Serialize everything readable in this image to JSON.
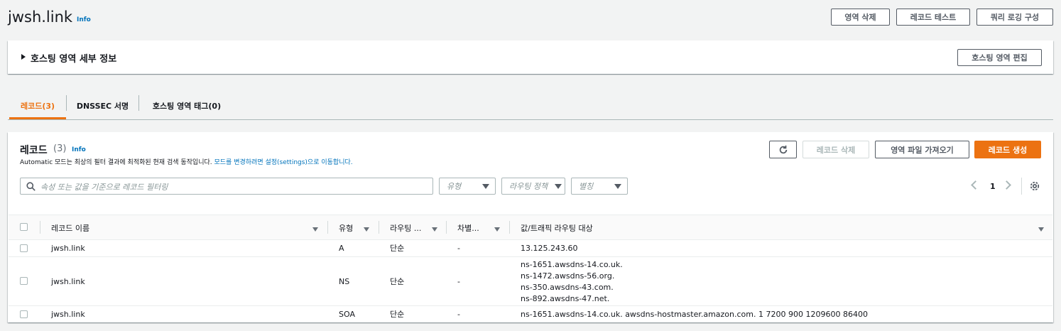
{
  "header": {
    "title": "jwsh.link",
    "info": "Info",
    "buttons": {
      "delete_zone": "영역 삭제",
      "test_record": "레코드 테스트",
      "query_logging": "쿼리 로깅 구성"
    }
  },
  "details": {
    "title": "호스팅 영역 세부 정보",
    "edit_button": "호스팅 영역 편집"
  },
  "tabs": [
    {
      "label": "레코드(3)",
      "active": true
    },
    {
      "label": "DNSSEC 서명",
      "active": false
    },
    {
      "label": "호스팅 영역 태그(0)",
      "active": false
    }
  ],
  "records": {
    "title": "레코드",
    "count": "(3)",
    "info": "Info",
    "description": "Automatic 모드는 최상의 필터 결과에 최적화된 현재 검색 동작입니다.",
    "description_link": "모드를 변경하려면 설정(settings)으로 이동합니다.",
    "buttons": {
      "delete": "레코드 삭제",
      "import": "영역 파일 가져오기",
      "create": "레코드 생성"
    },
    "search_placeholder": "속성 또는 값을 기준으로 레코드 필터링",
    "filters": {
      "type": "유형",
      "routing": "라우팅 정책",
      "alias": "별칭"
    },
    "page": "1",
    "columns": {
      "name": "레코드 이름",
      "type": "유형",
      "routing": "라우팅 ...",
      "differentiator": "차별...",
      "value": "값/트래픽 라우팅 대상"
    },
    "rows": [
      {
        "name": "jwsh.link",
        "type": "A",
        "routing": "단순",
        "diff": "-",
        "values": [
          "13.125.243.60"
        ]
      },
      {
        "name": "jwsh.link",
        "type": "NS",
        "routing": "단순",
        "diff": "-",
        "values": [
          "ns-1651.awsdns-14.co.uk.",
          "ns-1472.awsdns-56.org.",
          "ns-350.awsdns-43.com.",
          "ns-892.awsdns-47.net."
        ]
      },
      {
        "name": "jwsh.link",
        "type": "SOA",
        "routing": "단순",
        "diff": "-",
        "values": [
          "ns-1651.awsdns-14.co.uk. awsdns-hostmaster.amazon.com. 1 7200 900 1209600 86400"
        ]
      }
    ]
  },
  "colors": {
    "accent": "#ec7211",
    "link": "#0073bb",
    "background": "#f2f3f3"
  }
}
